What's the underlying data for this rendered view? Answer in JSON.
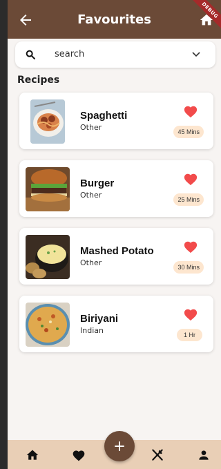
{
  "appbar": {
    "title": "Favourites",
    "debug_label": "DEBUG"
  },
  "search": {
    "placeholder": "search"
  },
  "section": {
    "title": "Recipes"
  },
  "recipes": [
    {
      "name": "Spaghetti",
      "category": "Other",
      "time": "45 Mins"
    },
    {
      "name": "Burger",
      "category": "Other",
      "time": "25 Mins"
    },
    {
      "name": "Mashed Potato",
      "category": "Other",
      "time": "30 Mins"
    },
    {
      "name": "Biriyani",
      "category": "Indian",
      "time": "1 Hr"
    }
  ],
  "colors": {
    "primary": "#6b4a37",
    "nav_bg": "#e9cfb6",
    "heart": "#f24b4b",
    "badge_bg": "#fde6cf"
  },
  "nav": {
    "icons": [
      "home-icon",
      "heart-icon",
      "add-icon",
      "utensils-icon",
      "person-icon"
    ]
  }
}
